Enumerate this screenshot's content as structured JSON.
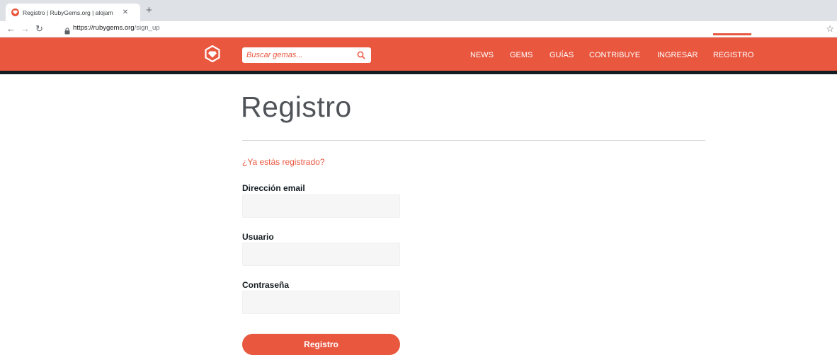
{
  "browser": {
    "tab": {
      "title": "Registro | RubyGems.org | alojam"
    },
    "url": {
      "host": "https://rubygems.org",
      "path": "/sign_up"
    }
  },
  "header": {
    "search": {
      "placeholder": "Buscar gemas..."
    },
    "nav": [
      {
        "label": "NEWS"
      },
      {
        "label": "GEMS"
      },
      {
        "label": "GUÍAS"
      },
      {
        "label": "CONTRIBUYE"
      },
      {
        "label": "INGRESAR"
      },
      {
        "label": "REGISTRO",
        "active": true
      }
    ]
  },
  "page": {
    "title": "Registro",
    "login_link": "¿Ya estás registrado?",
    "fields": [
      {
        "label": "Dirección email",
        "value": ""
      },
      {
        "label": "Usuario",
        "value": ""
      },
      {
        "label": "Contraseña",
        "value": ""
      }
    ],
    "submit_label": "Registro"
  },
  "colors": {
    "brand": "#e9573f",
    "header_border": "#141c22"
  }
}
